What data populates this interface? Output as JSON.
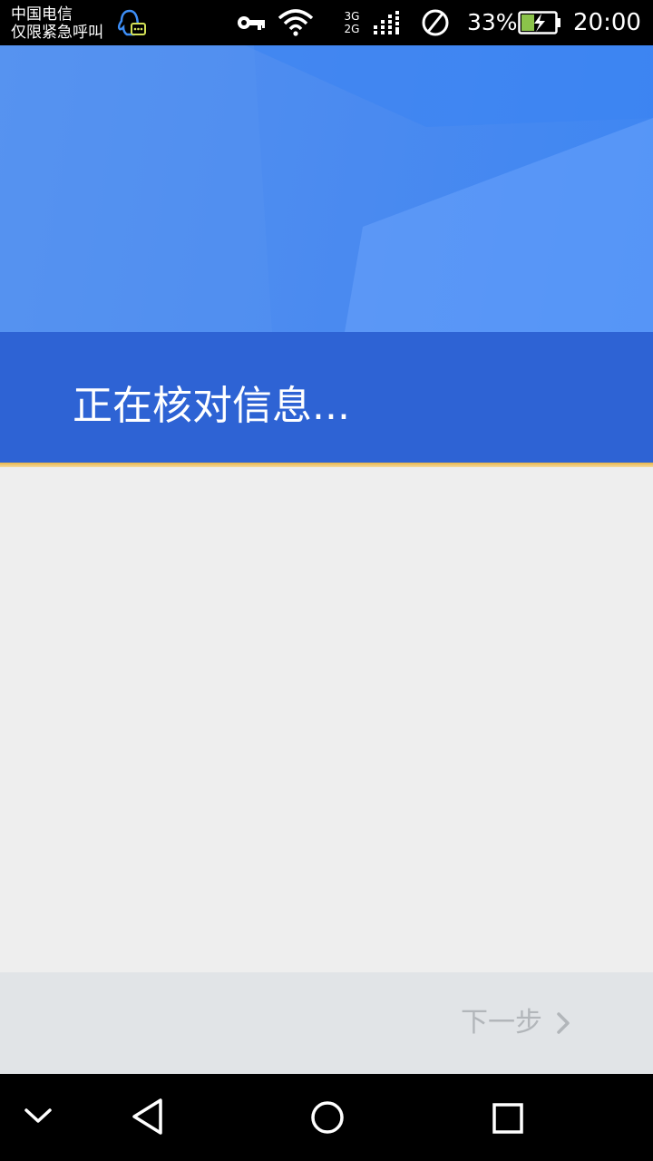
{
  "status_bar": {
    "carrier_line1": "中国电信",
    "carrier_line2": "仅限紧急呼叫",
    "network_top": "3G",
    "network_bottom": "2G",
    "battery_percent": "33%",
    "time": "20:00",
    "icons": [
      "qq-notification-icon",
      "vpn-key-icon",
      "wifi-icon",
      "signal-icon",
      "no-sim-icon",
      "battery-charging-icon"
    ],
    "battery_color": "#8bc34a"
  },
  "header": {
    "title": "正在核对信息...",
    "band_color": "#2e63d4",
    "accent_line_color": "#e9b649"
  },
  "footer": {
    "next_label": "下一步",
    "next_icon": "chevron-right-icon",
    "label_color": "#b2b6ba"
  },
  "nav_bar": {
    "buttons": [
      "collapse-icon",
      "back-icon",
      "home-icon",
      "recents-icon"
    ]
  }
}
